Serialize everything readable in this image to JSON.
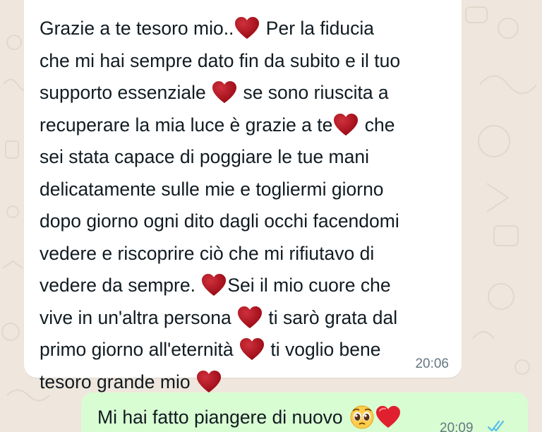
{
  "chat": {
    "incoming": {
      "lines": [
        [
          "Grazie a te tesoro mio..",
          "heart",
          " Per la fiducia"
        ],
        [
          "che mi hai sempre dato fin da subito e il tuo"
        ],
        [
          "supporto essenziale ",
          "heart",
          " se sono riuscita a"
        ],
        [
          "recuperare la mia luce è grazie a te",
          "heart",
          " che"
        ],
        [
          "sei stata capace di poggiare le tue mani"
        ],
        [
          "delicatamente sulle mie e togliermi giorno"
        ],
        [
          "dopo giorno ogni dito dagli occhi facendomi"
        ],
        [
          "vedere e riscoprire ciò che mi rifiutavo di"
        ],
        [
          "vedere da sempre. ",
          "heart",
          "Sei il mio cuore che"
        ],
        [
          "vive in un'altra persona ",
          "heart",
          " ti sarò grata dal"
        ],
        [
          "primo giorno all'eternità ",
          "heart",
          " ti voglio bene"
        ],
        [
          "tesoro grande mio ",
          "heart"
        ]
      ],
      "time": "20:06"
    },
    "outgoing": {
      "text": "Mi hai fatto piangere di nuovo ",
      "emojis": [
        "pleading-face",
        "heart"
      ],
      "time": "20:09",
      "status_icon": "double-check-read-icon"
    }
  },
  "colors": {
    "background": "#efe7dd",
    "incoming_bubble": "#ffffff",
    "outgoing_bubble": "#d9fdd3",
    "heart": "#c0111f",
    "read_ticks": "#53bdeb",
    "timestamp": "#667781"
  }
}
